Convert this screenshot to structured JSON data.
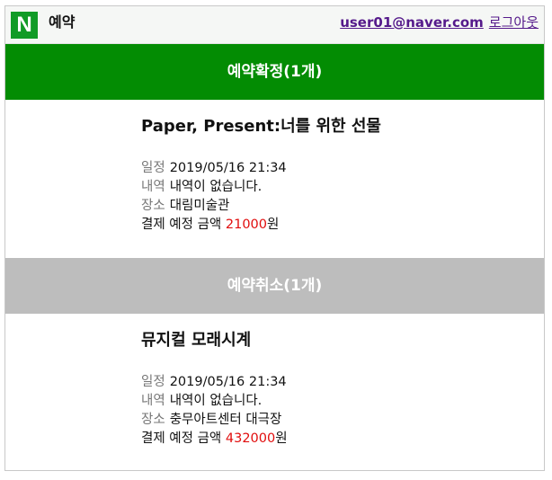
{
  "header": {
    "logo_text": "N",
    "title": "예약",
    "user_email": "user01@naver.com",
    "logout_label": "로그아웃"
  },
  "sections": [
    {
      "heading": "예약확정(1개)",
      "color": "#038c03",
      "booking": {
        "title": "Paper, Present:너를 위한 선물",
        "schedule_label": "일정",
        "schedule": "2019/05/16 21:34",
        "details_label": "내역",
        "details": "내역이 없습니다.",
        "venue_label": "장소",
        "venue": "대림미술관",
        "payment_label": "결제 예정 금액",
        "amount": "21000",
        "currency": "원"
      }
    },
    {
      "heading": "예약취소(1개)",
      "color": "#bdbdbd",
      "booking": {
        "title": "뮤지컬 모래시계",
        "schedule_label": "일정",
        "schedule": "2019/05/16 21:34",
        "details_label": "내역",
        "details": "내역이 없습니다.",
        "venue_label": "장소",
        "venue": "충무아트센터 대극장",
        "payment_label": "결제 예정 금액",
        "amount": "432000",
        "currency": "원"
      }
    }
  ]
}
